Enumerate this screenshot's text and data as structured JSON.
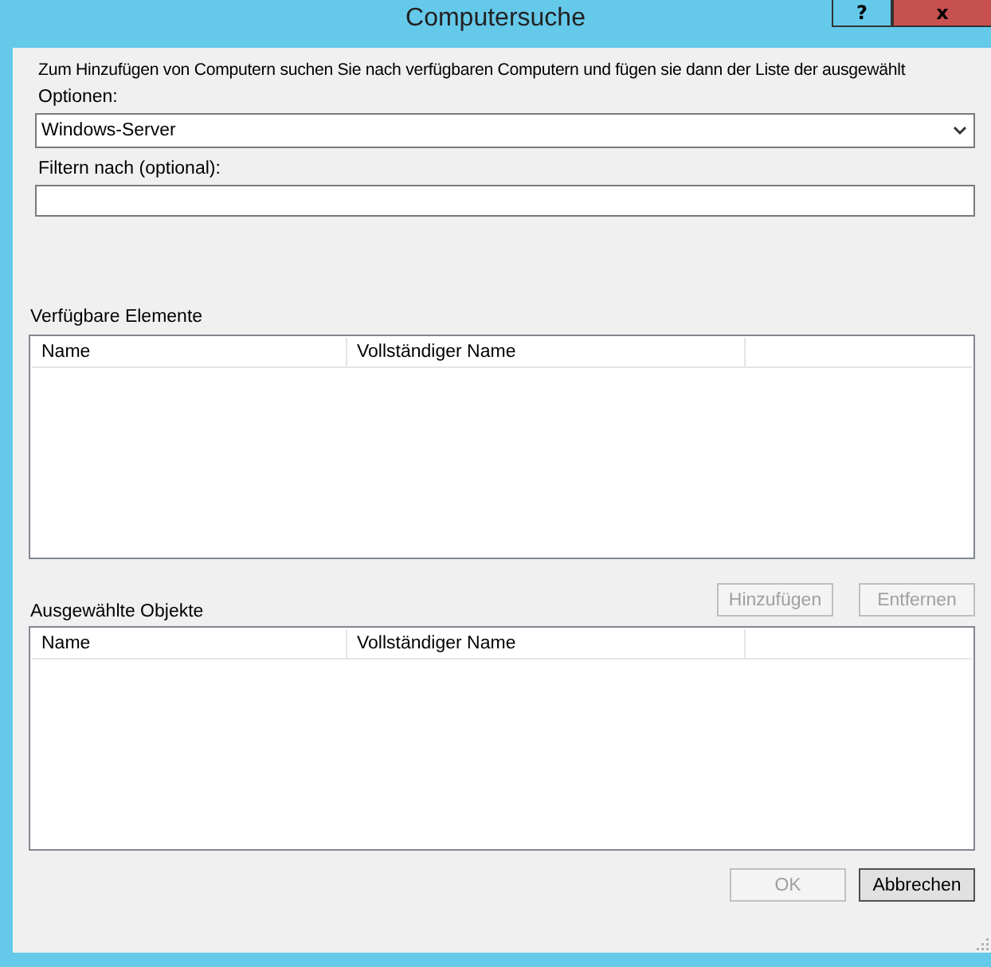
{
  "window": {
    "title": "Computersuche",
    "help_button": "?",
    "close_button": "x"
  },
  "intro": "Zum Hinzufügen von Computern suchen Sie nach verfügbaren Computern und fügen sie dann der Liste der ausgewählt",
  "options": {
    "label": "Optionen:",
    "value": "Windows-Server"
  },
  "filter": {
    "label": "Filtern nach (optional):"
  },
  "available": {
    "label": "Verfügbare Elemente",
    "columns": [
      "Name",
      "Vollständiger Name"
    ]
  },
  "action_buttons": [
    {
      "label": "Hinzufügen",
      "disabled": true
    },
    {
      "label": "Entfernen",
      "disabled": true
    }
  ],
  "selected": {
    "label": "Ausgewählte Objekte",
    "columns": [
      "Name",
      "Vollständiger Name"
    ]
  },
  "footer_buttons": [
    {
      "label": "OK",
      "disabled": true,
      "default": false
    },
    {
      "label": "Abbrechen",
      "disabled": false,
      "default": true
    }
  ]
}
